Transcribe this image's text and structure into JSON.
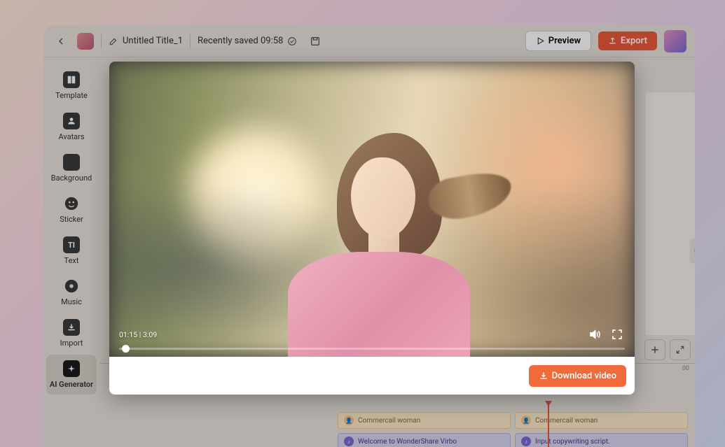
{
  "topbar": {
    "title": "Untitled Title_1",
    "saved": "Recently saved 09:58",
    "preview": "Preview",
    "export": "Export"
  },
  "sidebar": {
    "items": [
      {
        "label": "Template"
      },
      {
        "label": "Avatars"
      },
      {
        "label": "Background"
      },
      {
        "label": "Sticker"
      },
      {
        "label": "Text"
      },
      {
        "label": "Music"
      },
      {
        "label": "Import"
      },
      {
        "label": "AI Generator",
        "active": true
      }
    ]
  },
  "timeline": {
    "ruler_end": "00",
    "clips": {
      "avatar_label": "Commercail woman",
      "script1": "Welcome to WonderShare Virbo",
      "script2": "Input copywriting script."
    }
  },
  "preview_modal": {
    "current_time": "01:15",
    "total_time": "3:09",
    "download": "Download video"
  }
}
